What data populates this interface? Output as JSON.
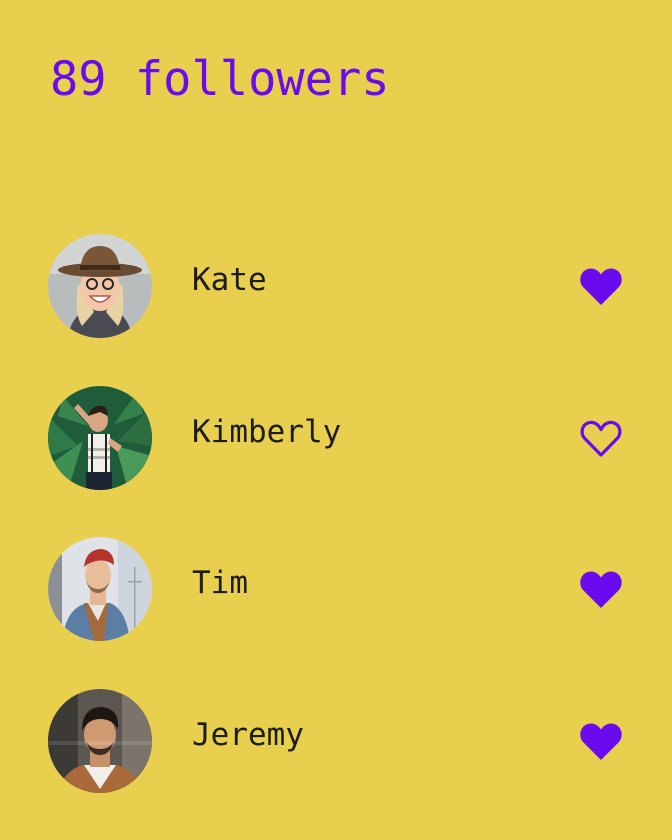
{
  "header": {
    "title": "89 followers"
  },
  "colors": {
    "background": "#E8CF4E",
    "accent": "#6A0BEE",
    "text": "#1D1D1D"
  },
  "followers": [
    {
      "name": "Kate",
      "liked": true,
      "avatar_icon": "avatar-photo"
    },
    {
      "name": "Kimberly",
      "liked": false,
      "avatar_icon": "avatar-photo"
    },
    {
      "name": "Tim",
      "liked": true,
      "avatar_icon": "avatar-photo"
    },
    {
      "name": "Jeremy",
      "liked": true,
      "avatar_icon": "avatar-photo"
    }
  ]
}
